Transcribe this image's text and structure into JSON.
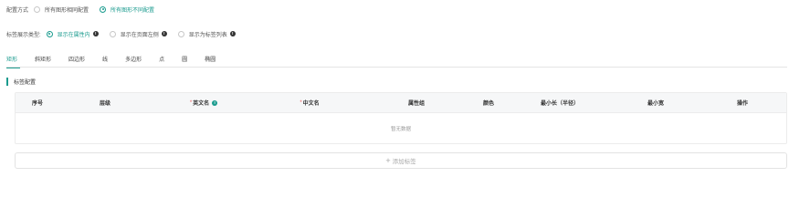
{
  "config": {
    "title": "配置方式",
    "options": [
      {
        "label": "所有图形相同配置",
        "checked": false
      },
      {
        "label": "所有图形不同配置",
        "checked": true
      }
    ]
  },
  "label_display": {
    "title": "标签展示类型:",
    "options": [
      {
        "label": "显示在属性内",
        "checked": true,
        "info": true
      },
      {
        "label": "显示在页面左侧",
        "checked": false,
        "info": true
      },
      {
        "label": "显示为标签列表",
        "checked": false,
        "info": true
      }
    ]
  },
  "tabs": [
    "矩形",
    "斜矩形",
    "四边形",
    "线",
    "多边形",
    "点",
    "圆",
    "椭圆"
  ],
  "active_tab": 0,
  "section_title": "标签配置",
  "table": {
    "columns": [
      "序号",
      "层级",
      "英文名",
      "中文名",
      "属性组",
      "颜色",
      "最小长（半径）",
      "最小宽",
      "操作"
    ],
    "empty_text": "暂无数据"
  },
  "add_button": {
    "icon": "plus-icon",
    "label": "添加标签"
  },
  "colors": {
    "accent": "#1a9b8e",
    "required": "#e85b5b"
  }
}
